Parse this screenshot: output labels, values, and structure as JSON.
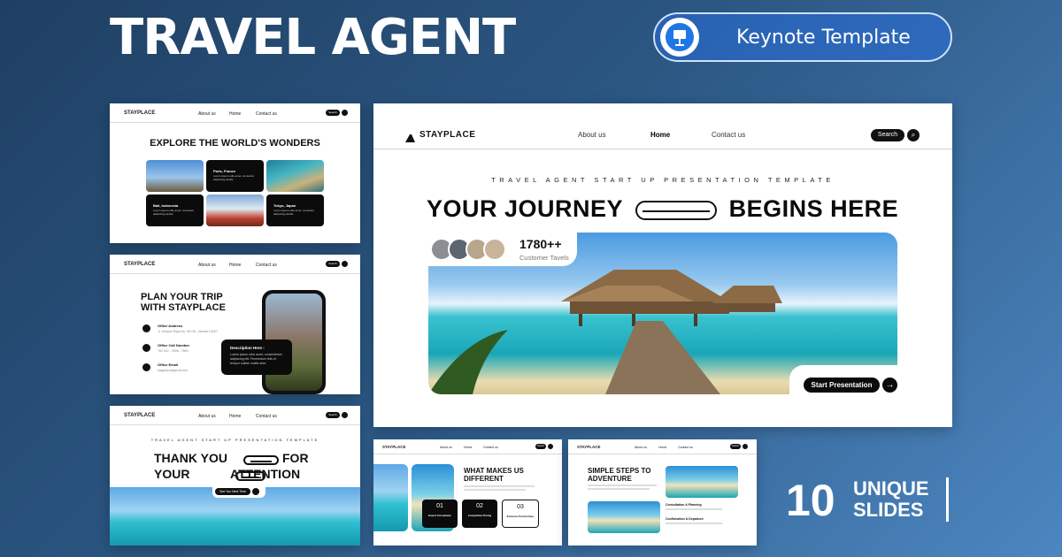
{
  "header": {
    "title": "TRAVEL AGENT",
    "badge_label": "Keynote Template",
    "badge_icon": "keynote-presentation-icon"
  },
  "mini_nav": {
    "brand": "STAYPLACE",
    "about": "About us",
    "home": "Home",
    "contact": "Contact us",
    "search": "Search"
  },
  "slide_explore": {
    "title": "EXPLORE THE WORLD'S WONDERS",
    "cards": [
      {
        "place": "Paris, France",
        "text": "Lorem ipsum odio amet, consectet adipiscing iaculis"
      },
      {
        "place": "Bali, Indonesia",
        "text": "Lorem ipsum odio amet, consectet adipiscing iaculis"
      },
      {
        "place": "Tokyo, Japan",
        "text": "Lorem ipsum odio amet, consectet adipiscing iaculis"
      }
    ]
  },
  "slide_plan": {
    "title_line1": "PLAN YOUR TRIP",
    "title_line2": "WITH STAYPLACE",
    "contacts": [
      {
        "label": "Office Address",
        "value": "Jl. Jempus Raya No. 56 Cib, Jakarta 13410",
        "icon": "map-pin-icon"
      },
      {
        "label": "Office Call Number",
        "value": "+62 012 - 3456 - 7890",
        "icon": "phone-icon"
      },
      {
        "label": "Office Email",
        "value": "stayplace@gmail.com",
        "icon": "email-icon"
      }
    ],
    "description_title": "Description Here :",
    "description_text": "Lorem ipsum odor amet, consectetuer adipiscing elit. Fermentum felis et tempor nullam mattis ante."
  },
  "slide_thanks": {
    "subtitle": "TRAVEL AGENT START UP PRESENTATION TEMPLATE",
    "line1_a": "THANK YOU",
    "line1_b": "FOR",
    "line2_a": "YOUR",
    "line2_b": "ATTENTION",
    "button": "See You Next Time"
  },
  "slide_main": {
    "brand": "STAYPLACE",
    "nav": [
      "About us",
      "Home",
      "Contact us"
    ],
    "search": "Search",
    "subtitle": "TRAVEL AGENT START UP PRESENTATION TEMPLATE",
    "headline_a": "YOUR JOURNEY",
    "headline_b": "BEGINS HERE",
    "stat_value": "1780++",
    "stat_label": "Customer Tavels",
    "cta": "Start Presentation"
  },
  "slide_different": {
    "title_line1": "WHAT MAKES US",
    "title_line2": "DIFFERENT",
    "steps": [
      {
        "num": "01",
        "label": "Expert Consultants"
      },
      {
        "num": "02",
        "label": "Competitive Pricing"
      },
      {
        "num": "03",
        "label": "Exclusive Partnerships"
      }
    ]
  },
  "slide_steps": {
    "title_line1": "SIMPLE STEPS TO",
    "title_line2": "ADVENTURE",
    "items": [
      {
        "label": "Consultation & Planning"
      },
      {
        "label": "Confirmation & Departure"
      }
    ]
  },
  "footer": {
    "count": "10",
    "word1": "UNIQUE",
    "word2": "SLIDES"
  }
}
